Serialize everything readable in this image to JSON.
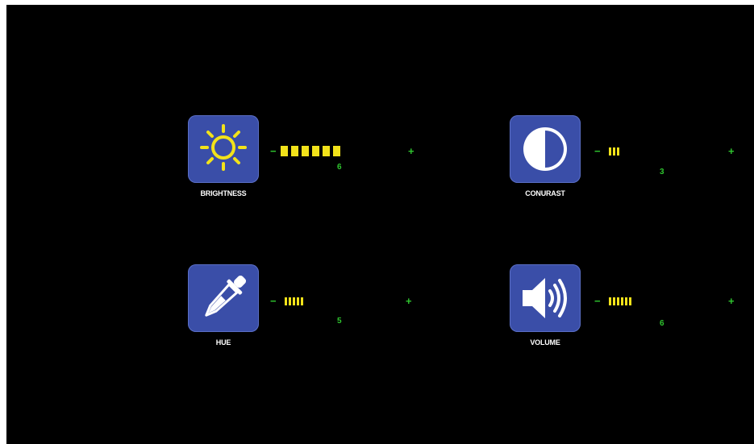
{
  "colors": {
    "tile": "#3a4ea8",
    "bar": "#f2e21a",
    "text_green": "#2fc52f",
    "background": "#000000"
  },
  "controls": [
    {
      "id": "brightness",
      "icon": "sun-icon",
      "label": "BRIGHTNESS",
      "minus": "−",
      "plus": "+",
      "value": "6",
      "level": 6,
      "bar_style": "blocks"
    },
    {
      "id": "contrast",
      "icon": "contrast-icon",
      "label": "CONURAST",
      "minus": "−",
      "plus": "+",
      "value": "3",
      "level": 3,
      "bar_style": "ticks"
    },
    {
      "id": "hue",
      "icon": "eyedropper-icon",
      "label": "HUE",
      "minus": "−",
      "plus": "+",
      "value": "5",
      "level": 5,
      "bar_style": "ticks"
    },
    {
      "id": "volume",
      "icon": "speaker-icon",
      "label": "VOLUME",
      "minus": "−",
      "plus": "+",
      "value": "6",
      "level": 6,
      "bar_style": "ticks"
    }
  ]
}
